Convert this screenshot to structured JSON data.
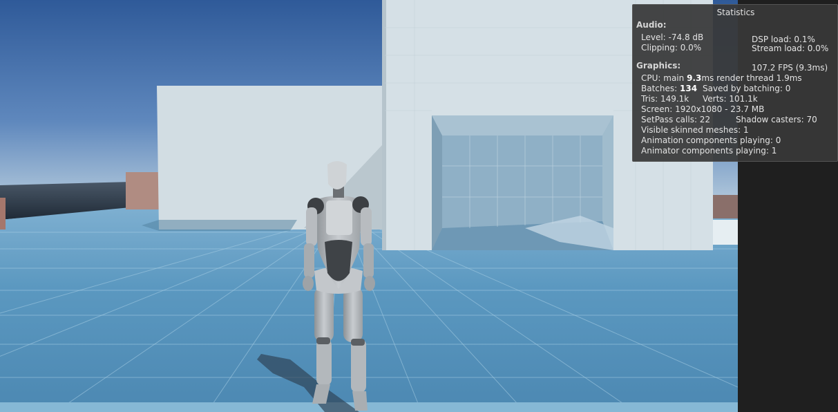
{
  "stats": {
    "title": "Statistics",
    "audio": {
      "header": "Audio:",
      "level": "Level: -74.8 dB",
      "clipping": "Clipping: 0.0%",
      "dsp": "DSP load: 0.1%",
      "stream": "Stream load: 0.0%"
    },
    "graphics": {
      "header": "Graphics:",
      "fps": "107.2 FPS (9.3ms)",
      "cpu_prefix": "CPU: main ",
      "cpu_main": "9.3",
      "cpu_suffix": "ms  render thread 1.9ms",
      "batches_prefix": "Batches: ",
      "batches": "134",
      "saved_batching": "Saved by batching: 0",
      "tris": "Tris: 149.1k",
      "verts": "Verts: 101.1k",
      "screen": "Screen: 1920x1080 - 23.7 MB",
      "setpass": "SetPass calls: 22",
      "shadow_casters": "Shadow casters: 70",
      "skinned_meshes": "Visible skinned meshes: 1",
      "animation_components": "Animation components playing: 0",
      "animator_components": "Animator components playing: 1"
    }
  },
  "colors": {
    "sky_top": "#2f5a99",
    "sky_horizon": "#a3bdd6",
    "ground": "#5391ba",
    "wall": "#cfdbe1",
    "panel": "#383838",
    "editor_bg": "#1f1f1f"
  }
}
